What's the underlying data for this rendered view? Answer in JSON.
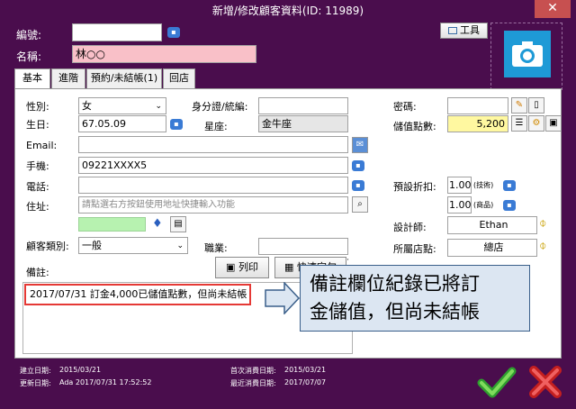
{
  "window": {
    "title": "新增/修改顧客資料(ID: 11989)",
    "close": "✕"
  },
  "top": {
    "id_label": "編號:",
    "id_value": "",
    "name_label": "名稱:",
    "name_value": "林○○",
    "tools_label": "工具"
  },
  "tabs": [
    "基本",
    "進階",
    "預約/未結帳(1)",
    "回店"
  ],
  "form": {
    "gender_label": "性別:",
    "gender_value": "女",
    "birthday_label": "生日:",
    "birthday_value": "67.05.09",
    "email_label": "Email:",
    "email_value": "",
    "mobile_label": "手機:",
    "mobile_value": "09221XXXX5",
    "phone_label": "電話:",
    "phone_value": "",
    "address_label": "住址:",
    "address_placeholder": "請點選右方按鈕使用地址快捷輸入功能",
    "idcard_label": "身分證/統編:",
    "idcard_value": "",
    "zodiac_label": "星座:",
    "zodiac_value": "金牛座",
    "password_label": "密碼:",
    "password_value": "",
    "points_label": "儲值點數:",
    "points_value": "5,200",
    "discount_label": "預設折扣:",
    "discount_tech_value": "1.00",
    "discount_tech_unit": "(技術)",
    "discount_product_value": "1.00",
    "discount_product_unit": "(商品)",
    "designer_label": "設計師:",
    "designer_value": "Ethan",
    "store_label": "所屬店點:",
    "store_value": "總店",
    "category_label": "顧客類別:",
    "category_value": "一般",
    "job_label": "職業:",
    "job_value": "",
    "note_label": "備註:",
    "print_label": "列印",
    "quick_text_label": "快速字句",
    "note_text": "2017/07/31 訂金4,000已儲值點數，但尚未結帳"
  },
  "callout": {
    "line1": "備註欄位紀錄已將訂",
    "line2": "金儲值，但尚未結帳"
  },
  "footer": {
    "created_label": "建立日期:",
    "created_value": "2015/03/21",
    "updated_label": "更新日期:",
    "updated_value": "Ada 2017/07/31 17:52:52",
    "first_buy_label": "首次消費日期:",
    "first_buy_value": "2015/03/21",
    "last_buy_label": "最近消費日期:",
    "last_buy_value": "2017/07/07"
  },
  "colors": {
    "window_bg": "#4a0d4d",
    "name_bg": "#f9c0c8",
    "points_bg": "#fff8a0",
    "note_highlight": "#e53935",
    "callout_bg": "#dce6f2",
    "camera_bg": "#1e9ad6"
  }
}
